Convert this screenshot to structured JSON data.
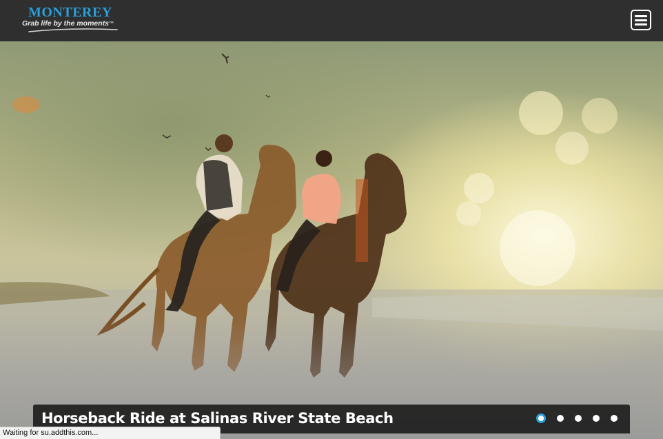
{
  "header": {
    "logo": {
      "title": "MONTEREY",
      "tagline": "Grab life by the moments",
      "tagline_mark": "™"
    },
    "menu_icon": "hamburger-menu-icon"
  },
  "hero": {
    "slide_title": "Horseback Ride at Salinas River State Beach",
    "slides_total": 5,
    "active_slide": 1,
    "image": "two-riders-on-horses-beach-sunlight"
  },
  "status_bar": {
    "text": "Waiting for su.addthis.com..."
  },
  "colors": {
    "header_bg": "#2f2f2f",
    "brand_blue": "#2a9fd9",
    "caption_bg": "#1e1e1e"
  }
}
